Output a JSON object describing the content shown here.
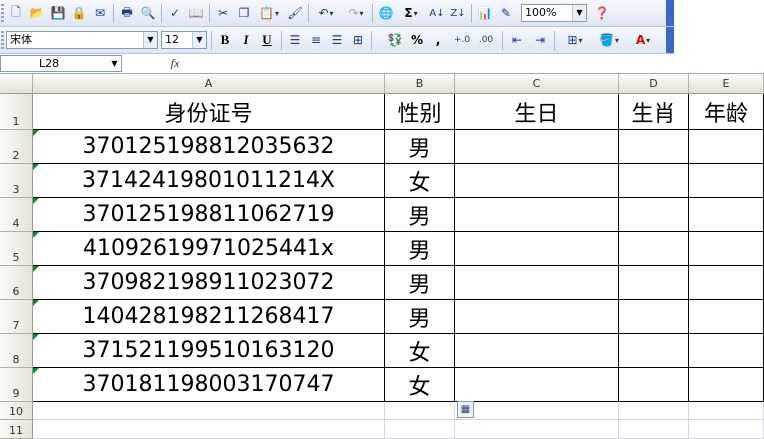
{
  "toolbar1": {
    "zoom": "100%",
    "icons": [
      "new-icon",
      "open-icon",
      "save-icon",
      "permission-icon",
      "print-icon",
      "print-preview-icon",
      "spelling-icon",
      "research-icon",
      "cut-icon",
      "copy-icon",
      "paste-icon",
      "format-painter-icon",
      "undo-icon",
      "redo-icon",
      "hyperlink-icon",
      "autosum-icon",
      "sort-ascending-icon",
      "sort-descending-icon",
      "chart-wizard-icon",
      "drawing-icon",
      "help-icon"
    ]
  },
  "toolbar2": {
    "font_name": "宋体",
    "font_size": "12",
    "bold": "B",
    "italic": "I",
    "underline": "U",
    "percent": "%",
    "comma": ","
  },
  "formula_bar": {
    "name_box": "L28",
    "fx": "fx",
    "value": ""
  },
  "columns": [
    "A",
    "B",
    "C",
    "D",
    "E"
  ],
  "row_numbers": [
    "1",
    "2",
    "3",
    "4",
    "5",
    "6",
    "7",
    "8",
    "9",
    "10",
    "11"
  ],
  "sheet": {
    "headers": [
      "身份证号",
      "性别",
      "生日",
      "生肖",
      "年龄"
    ],
    "rows": [
      {
        "id": "370125198812035632",
        "gender": "男"
      },
      {
        "id": "37142419801011214X",
        "gender": "女"
      },
      {
        "id": "370125198811062719",
        "gender": "男"
      },
      {
        "id": "41092619971025441x",
        "gender": "男"
      },
      {
        "id": "370982198911023072",
        "gender": "男"
      },
      {
        "id": "140428198211268417",
        "gender": "男"
      },
      {
        "id": "371521199510163120",
        "gender": "女"
      },
      {
        "id": "370181198003170747",
        "gender": "女"
      }
    ]
  },
  "colors": {
    "toolbar_bg": "#dfe6f3",
    "header_bg": "#e4e2d6",
    "error_triangle": "#0f8a2f",
    "gridline": "#d0d7e5"
  }
}
